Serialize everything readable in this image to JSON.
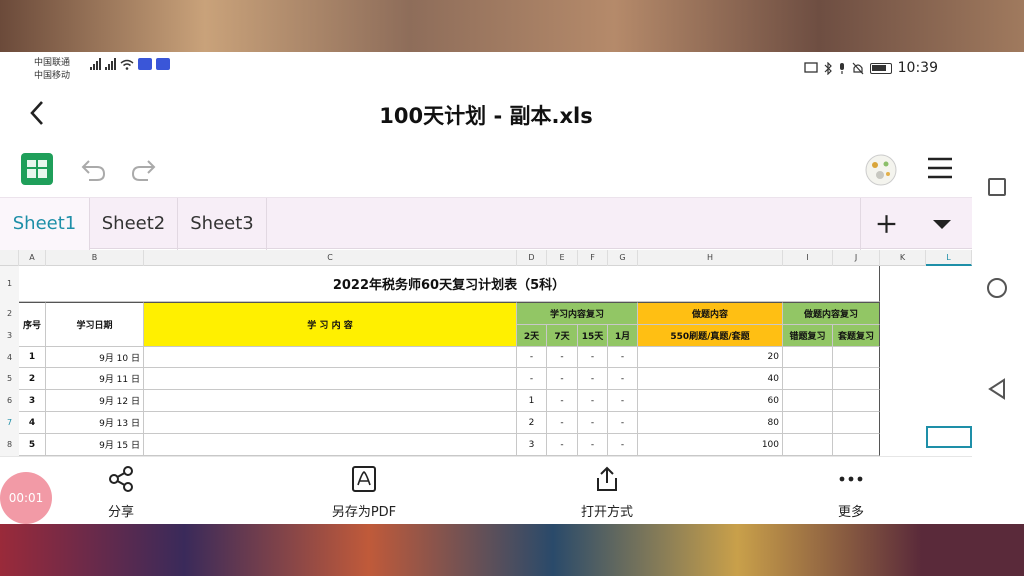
{
  "status": {
    "carrier1": "中国联通",
    "carrier2": "中国移动",
    "time": "10:39"
  },
  "header": {
    "title": "100天计划 - 副本.xls"
  },
  "tabs": [
    {
      "label": "Sheet1"
    },
    {
      "label": "Sheet2"
    },
    {
      "label": "Sheet3"
    }
  ],
  "columns": [
    "A",
    "B",
    "C",
    "D",
    "E",
    "F",
    "G",
    "H",
    "I",
    "J",
    "K",
    "L"
  ],
  "row_numbers": [
    "1",
    "2",
    "3",
    "4",
    "5",
    "6",
    "7",
    "8"
  ],
  "table": {
    "title": "2022年税务师60天复习计划表（5科）",
    "h_seq": "序号",
    "h_date": "学习日期",
    "h_content": "学 习 内 容",
    "h_review": "学习内容复习",
    "h_practice": "做题内容",
    "h_practice_review": "做题内容复习",
    "h_2d": "2天",
    "h_7d": "7天",
    "h_15d": "15天",
    "h_1m": "1月",
    "h_550": "550刷题/真题/套题",
    "h_wrong": "错题复习",
    "h_set": "套题复习",
    "rows": [
      {
        "seq": "1",
        "date": "9月 10 日",
        "d2": "-",
        "d7": "-",
        "d15": "-",
        "m1": "-",
        "practice": "20"
      },
      {
        "seq": "2",
        "date": "9月 11 日",
        "d2": "-",
        "d7": "-",
        "d15": "-",
        "m1": "-",
        "practice": "40"
      },
      {
        "seq": "3",
        "date": "9月 12 日",
        "d2": "1",
        "d7": "-",
        "d15": "-",
        "m1": "-",
        "practice": "60"
      },
      {
        "seq": "4",
        "date": "9月 13 日",
        "d2": "2",
        "d7": "-",
        "d15": "-",
        "m1": "-",
        "practice": "80"
      },
      {
        "seq": "5",
        "date": "9月 15 日",
        "d2": "3",
        "d7": "-",
        "d15": "-",
        "m1": "-",
        "practice": "100"
      }
    ]
  },
  "bottom": {
    "share": "分享",
    "pdf": "另存为PDF",
    "open": "打开方式",
    "more": "更多"
  },
  "recording_timer": "00:01",
  "colors": {
    "accent": "#1e8fa8",
    "green_header": "#92c665",
    "orange_header": "#ffbf13",
    "yellow_header": "#fff000",
    "app_green": "#1f9f5a"
  }
}
